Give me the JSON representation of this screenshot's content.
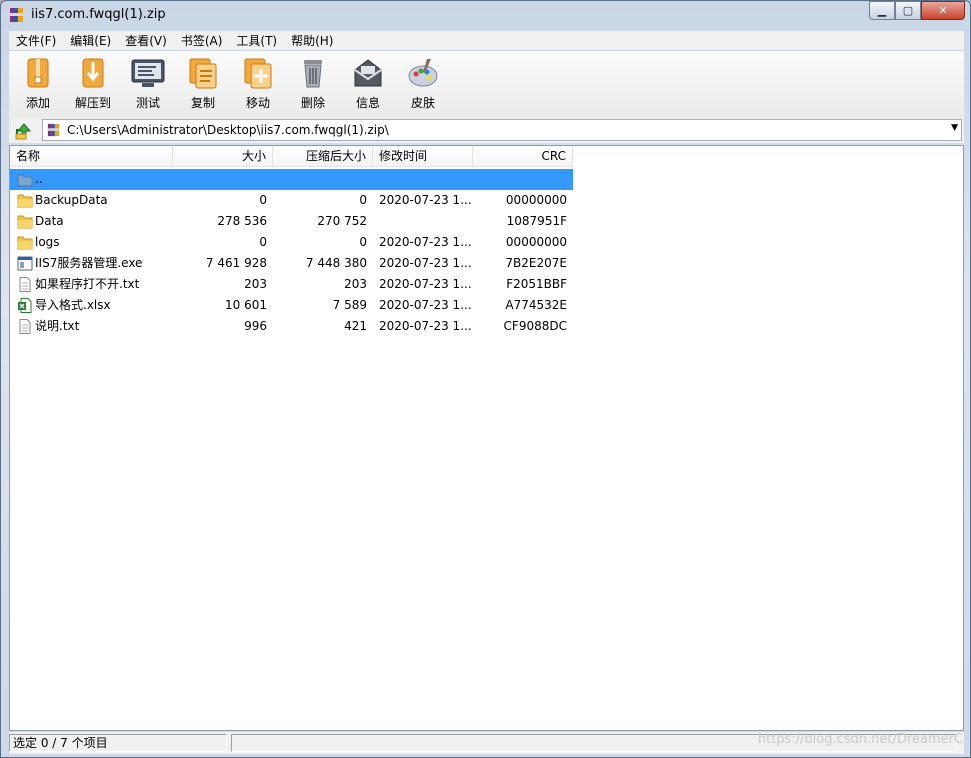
{
  "window": {
    "title": "iis7.com.fwqgl(1).zip",
    "buttons": {
      "minimize": "▁",
      "maximize": "▢",
      "close": "✕"
    }
  },
  "menu": [
    "文件(F)",
    "编辑(E)",
    "查看(V)",
    "书签(A)",
    "工具(T)",
    "帮助(H)"
  ],
  "toolbar": [
    {
      "label": "添加",
      "icon": "add-archive-icon"
    },
    {
      "label": "解压到",
      "icon": "extract-icon"
    },
    {
      "label": "测试",
      "icon": "test-icon"
    },
    {
      "label": "复制",
      "icon": "copy-icon"
    },
    {
      "label": "移动",
      "icon": "move-icon"
    },
    {
      "label": "删除",
      "icon": "delete-icon"
    },
    {
      "label": "信息",
      "icon": "info-icon"
    },
    {
      "label": "皮肤",
      "icon": "skin-icon"
    }
  ],
  "address": {
    "path": "C:\\Users\\Administrator\\Desktop\\iis7.com.fwqgl(1).zip\\",
    "dropdown": "▼"
  },
  "columns": {
    "name": "名称",
    "size": "大小",
    "packed": "压缩后大小",
    "modified": "修改时间",
    "crc": "CRC"
  },
  "files": [
    {
      "name": "..",
      "size": "",
      "packed": "",
      "modified": "",
      "crc": "",
      "icon": "parent-folder-icon",
      "selected": true
    },
    {
      "name": "BackupData",
      "size": "0",
      "packed": "0",
      "modified": "2020-07-23 1...",
      "crc": "00000000",
      "icon": "folder-icon"
    },
    {
      "name": "Data",
      "size": "278 536",
      "packed": "270 752",
      "modified": "",
      "crc": "1087951F",
      "icon": "folder-icon"
    },
    {
      "name": "logs",
      "size": "0",
      "packed": "0",
      "modified": "2020-07-23 1...",
      "crc": "00000000",
      "icon": "folder-icon"
    },
    {
      "name": "IIS7服务器管理.exe",
      "size": "7 461 928",
      "packed": "7 448 380",
      "modified": "2020-07-23 1...",
      "crc": "7B2E207E",
      "icon": "exe-icon"
    },
    {
      "name": "如果程序打不开.txt",
      "size": "203",
      "packed": "203",
      "modified": "2020-07-23 1...",
      "crc": "F2051BBF",
      "icon": "text-file-icon"
    },
    {
      "name": "导入格式.xlsx",
      "size": "10 601",
      "packed": "7 589",
      "modified": "2020-07-23 1...",
      "crc": "A774532E",
      "icon": "excel-file-icon"
    },
    {
      "name": "说明.txt",
      "size": "996",
      "packed": "421",
      "modified": "2020-07-23 1...",
      "crc": "CF9088DC",
      "icon": "text-file-icon"
    }
  ],
  "status": {
    "text": "选定 0 / 7 个项目"
  },
  "watermark": "https://blog.csdn.net/DreamerC"
}
